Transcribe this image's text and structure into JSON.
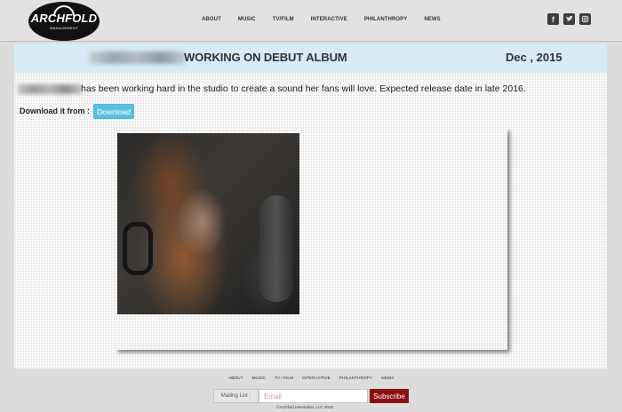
{
  "header": {
    "logo_text": "ARCHFOLD",
    "logo_subtext": "MANAGEMENT",
    "nav": [
      "ABOUT",
      "MUSIC",
      "TV/FILM",
      "INTERACTIVE",
      "PHILANTHROPY",
      "NEWS"
    ],
    "social_icons": [
      "facebook-icon",
      "twitter-icon",
      "instagram-icon"
    ]
  },
  "article": {
    "title": "WORKING ON DEBUT ALBUM",
    "date": "Dec , 2015",
    "body": "has been working hard in the studio to create a sound her fans will love. Expected release date in late 2016.",
    "download_label": "Download it from :",
    "download_button": "Download"
  },
  "footer": {
    "nav": [
      "ABOUT",
      "MUSIC",
      "TV / FILM",
      "INTERACTIVE",
      "PHILANTHROPY",
      "NEWS"
    ],
    "mailing_label": "Mailing List :",
    "email_placeholder": "Email",
    "subscribe_label": "Subscribe",
    "copyright": "©Archfold Interactive, LLC 2015"
  },
  "colors": {
    "title_bar": "#d6ebf6",
    "download_button": "#5bc0de",
    "subscribe_button": "#8b1010"
  }
}
